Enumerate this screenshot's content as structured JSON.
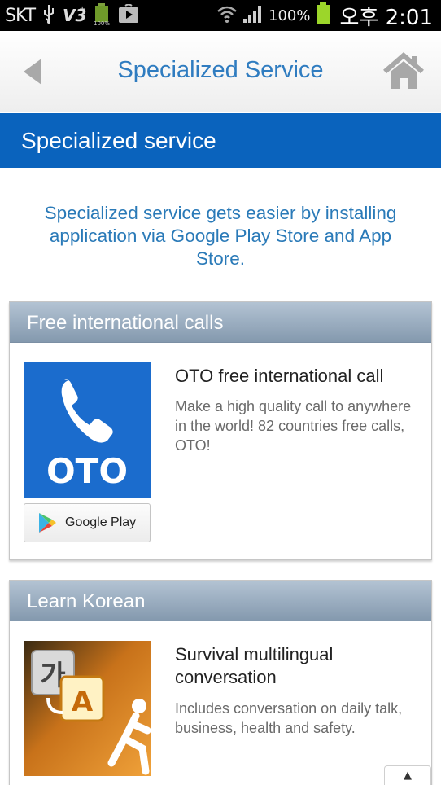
{
  "status_bar": {
    "carrier": "SKT",
    "battery_percent": "100%",
    "time": "오후 2:01",
    "icons": [
      "usb-icon",
      "v3-icon",
      "battery-small-icon",
      "play-store-icon",
      "wifi-icon",
      "signal-icon",
      "battery-icon"
    ]
  },
  "header": {
    "title": "Specialized Service",
    "back_icon": "back-arrow-icon",
    "home_icon": "home-icon"
  },
  "banner": {
    "title": "Specialized service"
  },
  "intro": {
    "text": "Specialized service gets easier by installing application via Google Play Store and App Store."
  },
  "cards": [
    {
      "category": "Free international calls",
      "app_name": "OTO free international call",
      "description": "Make a high quality call to anywhere in the world! 82 countries free calls, OTO!",
      "icon_text": "OTO",
      "store_button": "Google Play"
    },
    {
      "category": "Learn Korean",
      "app_name": "Survival multilingual conversation",
      "description": "Includes conversation on daily talk, business, health and safety.",
      "icon_text_ko": "가",
      "icon_text_a": "A"
    }
  ],
  "scroll_top": {
    "label": "▲"
  },
  "colors": {
    "accent_blue": "#0a63bd",
    "title_blue": "#2f7cc0",
    "oto_blue": "#1b6ccd",
    "card_header": "#8a9db1"
  }
}
